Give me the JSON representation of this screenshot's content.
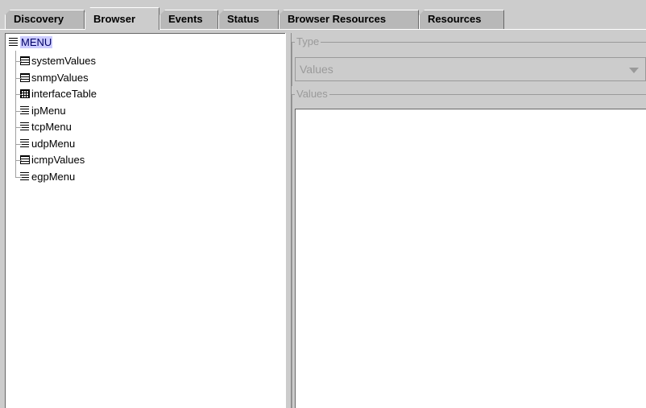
{
  "tabs": [
    {
      "label": "Discovery",
      "selected": false
    },
    {
      "label": "Browser",
      "selected": true
    },
    {
      "label": "Events",
      "selected": false
    },
    {
      "label": "Status",
      "selected": false
    },
    {
      "label": "Browser Resources",
      "selected": false
    },
    {
      "label": "Resources",
      "selected": false
    }
  ],
  "tree": {
    "root": {
      "label": "MENU",
      "icon": "menu-icon"
    },
    "items": [
      {
        "label": "systemValues",
        "icon": "table-icon"
      },
      {
        "label": "snmpValues",
        "icon": "table-icon"
      },
      {
        "label": "interfaceTable",
        "icon": "grid-icon"
      },
      {
        "label": "ipMenu",
        "icon": "menu-icon"
      },
      {
        "label": "tcpMenu",
        "icon": "menu-icon"
      },
      {
        "label": "udpMenu",
        "icon": "menu-icon"
      },
      {
        "label": "icmpValues",
        "icon": "table-icon"
      },
      {
        "label": "egpMenu",
        "icon": "menu-icon"
      }
    ]
  },
  "type_group": {
    "title": "Type",
    "selected_value": "Values"
  },
  "values_group": {
    "title": "Values"
  },
  "colors": {
    "background": "#cccccc",
    "selection": "#ccccff",
    "disabled_text": "#9a9a9a"
  }
}
